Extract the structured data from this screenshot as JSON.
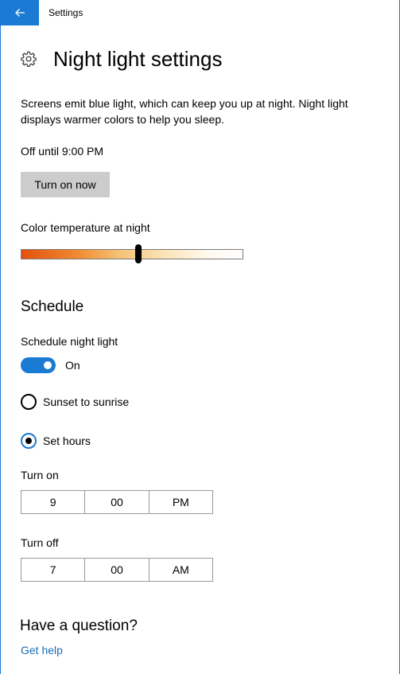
{
  "titlebar": {
    "title": "Settings",
    "back_icon": "back-arrow-icon"
  },
  "page": {
    "title": "Night light settings",
    "icon": "gear-icon",
    "description": "Screens emit blue light, which can keep you up at night. Night light displays warmer colors to help you sleep."
  },
  "status": {
    "text": "Off until 9:00 PM",
    "button_label": "Turn on now"
  },
  "color_temperature": {
    "label": "Color temperature at night",
    "value_fraction": 0.53
  },
  "schedule": {
    "section_title": "Schedule",
    "toggle_label": "Schedule night light",
    "toggle_state": "On",
    "toggle_on": true,
    "options": [
      {
        "label": "Sunset to sunrise",
        "selected": false
      },
      {
        "label": "Set hours",
        "selected": true
      }
    ],
    "turn_on": {
      "label": "Turn on",
      "hour": "9",
      "minute": "00",
      "period": "PM"
    },
    "turn_off": {
      "label": "Turn off",
      "hour": "7",
      "minute": "00",
      "period": "AM"
    }
  },
  "help": {
    "title": "Have a question?",
    "link": "Get help"
  },
  "colors": {
    "accent": "#1a7ad4",
    "link": "#1a6fb8",
    "button_bg": "#cccccc"
  }
}
